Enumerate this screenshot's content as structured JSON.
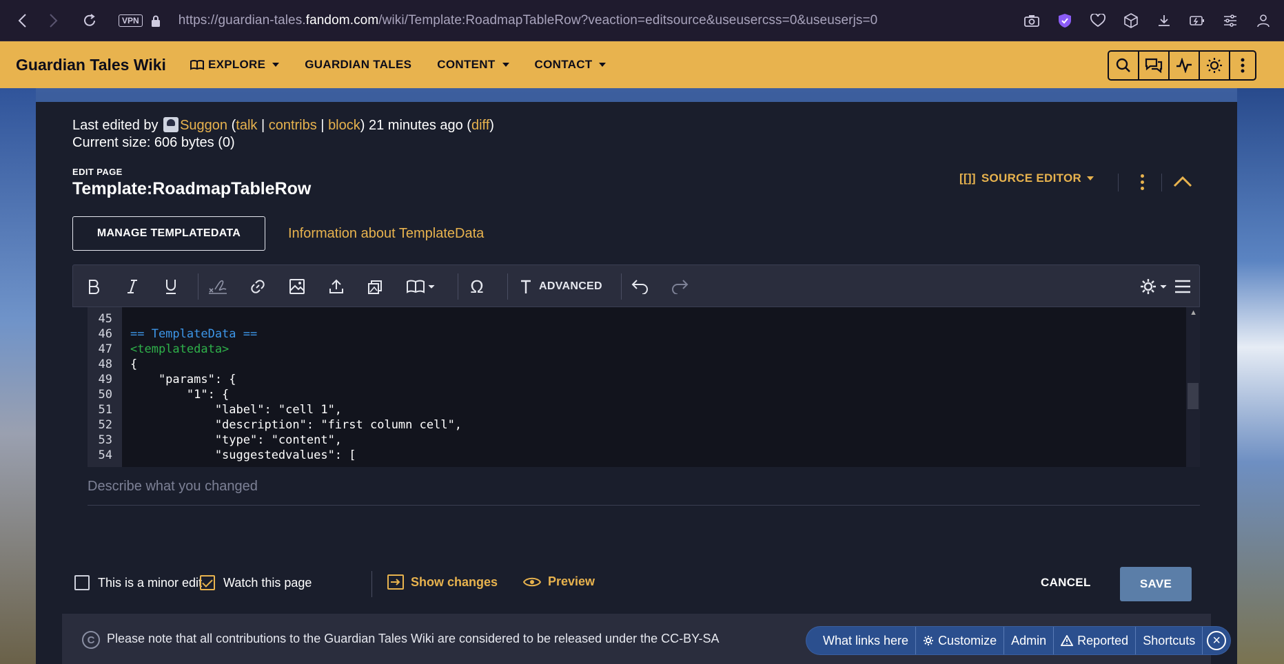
{
  "browser": {
    "vpn_label": "VPN",
    "url_prefix": "https://guardian-tales.",
    "url_host": "fandom.com",
    "url_path": "/wiki/Template:RoadmapTableRow?veaction=editsource&useusercss=0&useuserjs=0"
  },
  "header": {
    "wiki_name": "Guardian Tales Wiki",
    "nav": [
      {
        "label": "EXPLORE"
      },
      {
        "label": "GUARDIAN TALES"
      },
      {
        "label": "CONTENT"
      },
      {
        "label": "CONTACT"
      }
    ]
  },
  "meta": {
    "last_edited_prefix": "Last edited by",
    "user": "Suggon",
    "talk": "talk",
    "contribs": "contribs",
    "block": "block",
    "time": "21 minutes ago",
    "diff": "diff",
    "size": "Current size: 606 bytes (0)"
  },
  "editor_header": {
    "edit_label": "EDIT PAGE",
    "page_title": "Template:RoadmapTableRow",
    "source_editor_label": "SOURCE EDITOR",
    "source_editor_glyph": "[[]]",
    "manage_button": "MANAGE TEMPLATEDATA",
    "info_link": "Information about TemplateData"
  },
  "toolbar": {
    "advanced_label": "ADVANCED",
    "special_char": "Ω"
  },
  "code": {
    "lines": [
      {
        "num": "45",
        "text": ""
      },
      {
        "num": "46",
        "text": "== TemplateData =="
      },
      {
        "num": "47",
        "text": "<templatedata>"
      },
      {
        "num": "48",
        "text": "{"
      },
      {
        "num": "49",
        "text": "    \"params\": {"
      },
      {
        "num": "50",
        "text": "        \"1\": {"
      },
      {
        "num": "51",
        "text": "            \"label\": \"cell 1\","
      },
      {
        "num": "52",
        "text": "            \"description\": \"first column cell\","
      },
      {
        "num": "53",
        "text": "            \"type\": \"content\","
      },
      {
        "num": "54",
        "text": "            \"suggestedvalues\": ["
      }
    ]
  },
  "summary": {
    "placeholder": "Describe what you changed"
  },
  "options": {
    "minor_edit": "This is a minor edit",
    "watch": "Watch this page",
    "show_changes": "Show changes",
    "preview": "Preview",
    "cancel": "CANCEL",
    "save": "SAVE"
  },
  "footer": {
    "note": "Please note that all contributions to the Guardian Tales Wiki are considered to be released under the CC-BY-SA"
  },
  "floating_toolbar": {
    "what_links_here": "What links here",
    "customize": "Customize",
    "admin": "Admin",
    "reported": "Reported",
    "shortcuts": "Shortcuts"
  },
  "colors": {
    "accent": "#e8b34e",
    "panel": "#1a1e2c",
    "save": "#5b7ea8"
  }
}
